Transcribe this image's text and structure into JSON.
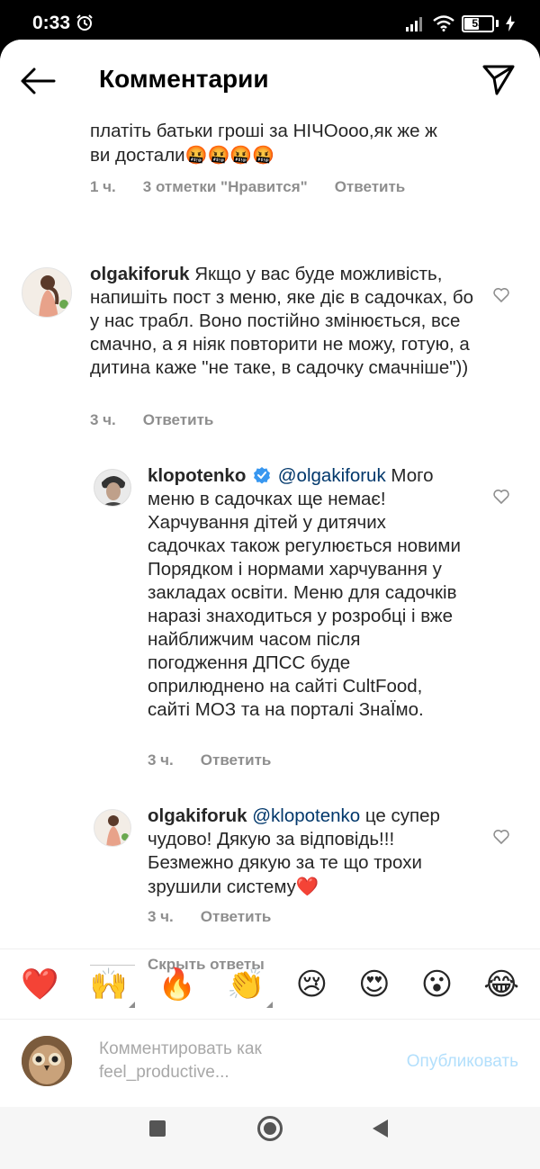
{
  "status": {
    "time": "0:33",
    "battery": "53",
    "battery_level": 0.53
  },
  "header": {
    "title": "Комментарии"
  },
  "prev_comment": {
    "text_line1": "платіть батьки гроші за НІЧОооо,як же ж",
    "text_line2": "ви достали",
    "emojis": "🤬🤬🤬🤬",
    "time": "1 ч.",
    "likes": "3 отметки \"Нравится\"",
    "reply": "Ответить"
  },
  "comment1": {
    "username": "olgakiforuk",
    "text": "Якщо у вас буде можливість, напишіть пост з меню, яке діє в садочках, бо у нас трабл. Воно постійно змінюється, все смачно, а я ніяк повторити не можу, готую, а дитина каже \"не таке, в садочку смачніше\"))",
    "time": "3 ч.",
    "reply": "Ответить"
  },
  "reply1": {
    "username": "klopotenko",
    "mention": "@olgakiforuk",
    "text": "Мого меню в садочках ще немає! Харчування дітей у дитячих садочках також регулюється новими Порядком і нормами харчування у закладах освіти. Меню для садочків наразі знаходиться у розробці і вже найближчим часом після погодження ДПСС буде оприлюднено на сайті CultFood, сайті МОЗ та на порталі ЗнаЇмо.",
    "time": "3 ч.",
    "reply": "Ответить"
  },
  "reply2": {
    "username": "olgakiforuk",
    "mention": "@klopotenko",
    "text": "це супер чудово! Дякую за відповідь!!! Безмежно дякую за те що трохи зрушили систему",
    "heart": "❤️",
    "time": "3 ч.",
    "reply": "Ответить"
  },
  "hide_replies": "Скрыть ответы",
  "emoji_bar": [
    "❤️",
    "🙌",
    "🔥",
    "👏",
    "😢",
    "😍",
    "😮",
    "😂"
  ],
  "compose": {
    "placeholder_line1": "Комментировать как",
    "placeholder_line2": "feel_productive...",
    "publish": "Опубликовать"
  },
  "colors": {
    "accent": "#0095f6",
    "publish_disabled": "#b2dffc",
    "verified": "#3897f0",
    "heart": "#ed4956"
  }
}
